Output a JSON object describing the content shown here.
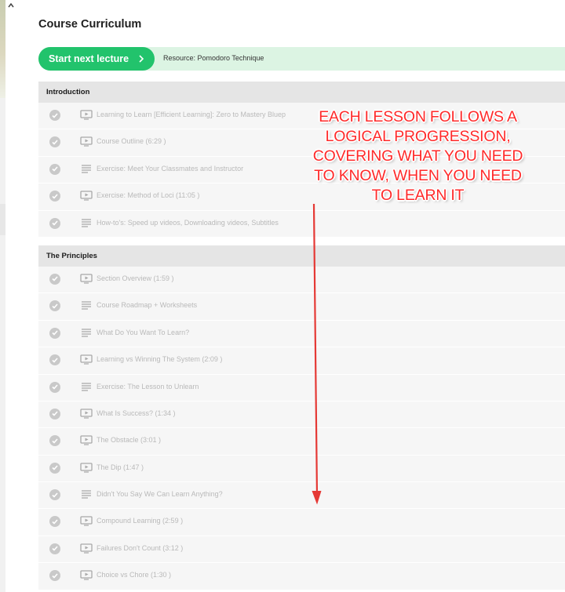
{
  "page": {
    "title": "Course Curriculum",
    "start_button": "Start next lecture",
    "resource": "Resource: Pomodoro Technique"
  },
  "sections": [
    {
      "title": "Introduction",
      "lessons": [
        {
          "title": "Learning to Learn [Efficient Learning]: Zero to Mastery Bluep",
          "type": "video"
        },
        {
          "title": "Course Outline (6:29 )",
          "type": "video"
        },
        {
          "title": "Exercise: Meet Your Classmates and Instructor",
          "type": "text"
        },
        {
          "title": "Exercise: Method of Loci (11:05 )",
          "type": "video"
        },
        {
          "title": "How-to's: Speed up videos, Downloading videos, Subtitles",
          "type": "text"
        }
      ]
    },
    {
      "title": "The Principles",
      "lessons": [
        {
          "title": "Section Overview (1:59 )",
          "type": "video"
        },
        {
          "title": "Course Roadmap + Worksheets",
          "type": "text"
        },
        {
          "title": "What Do You Want To Learn?",
          "type": "text"
        },
        {
          "title": "Learning vs Winning The System (2:09 )",
          "type": "video"
        },
        {
          "title": "Exercise: The Lesson to Unlearn",
          "type": "text"
        },
        {
          "title": "What Is Success? (1:34 )",
          "type": "video"
        },
        {
          "title": "The Obstacle (3:01 )",
          "type": "video"
        },
        {
          "title": "The Dip (1:47 )",
          "type": "video"
        },
        {
          "title": "Didn't You Say We Can Learn Anything?",
          "type": "text"
        },
        {
          "title": "Compound Learning (2:59 )",
          "type": "video"
        },
        {
          "title": "Failures Don't Count (3:12 )",
          "type": "video"
        },
        {
          "title": "Choice vs Chore (1:30 )",
          "type": "video"
        }
      ]
    }
  ],
  "annotation": {
    "lines": [
      "EACH LESSON FOLLOWS A",
      "LOGICAL PROGRESSION,",
      "COVERING WHAT YOU NEED",
      "TO KNOW, WHEN YOU NEED",
      "TO LEARN IT"
    ]
  },
  "colors": {
    "accent": "#22c36c",
    "banner": "#dcf4e3",
    "annotation": "#ff2a2a"
  }
}
